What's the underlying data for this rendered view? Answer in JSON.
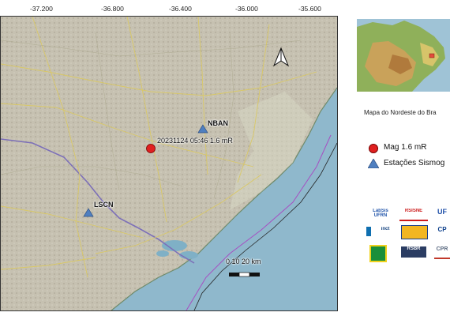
{
  "axis": {
    "x_ticks": [
      "-37.200",
      "-36.800",
      "-36.400",
      "-36.000",
      "-35.600"
    ]
  },
  "map": {
    "stations": [
      {
        "code": "NBAN"
      },
      {
        "code": "LSCN"
      }
    ],
    "event": {
      "label": "20231124 05:46 1.6 mR"
    },
    "scale": {
      "label": "0   10  20 km"
    },
    "colors": {
      "sea": "#8fb8cc",
      "land": "#c8c3b3",
      "event": "#e02020",
      "station": "#4f7fc0"
    }
  },
  "inset": {
    "caption": "Mapa do  Nordeste do Bra"
  },
  "legend": {
    "items": [
      {
        "symbol": "red-circle",
        "label": "Mag 1.6 mR"
      },
      {
        "symbol": "blue-triangle",
        "label": "Estações Sismog"
      }
    ]
  },
  "logos": [
    "LabSis UFRN",
    "RSISNE",
    "UF",
    "inct",
    "",
    "CP",
    "",
    "RSBR",
    "CPR"
  ]
}
